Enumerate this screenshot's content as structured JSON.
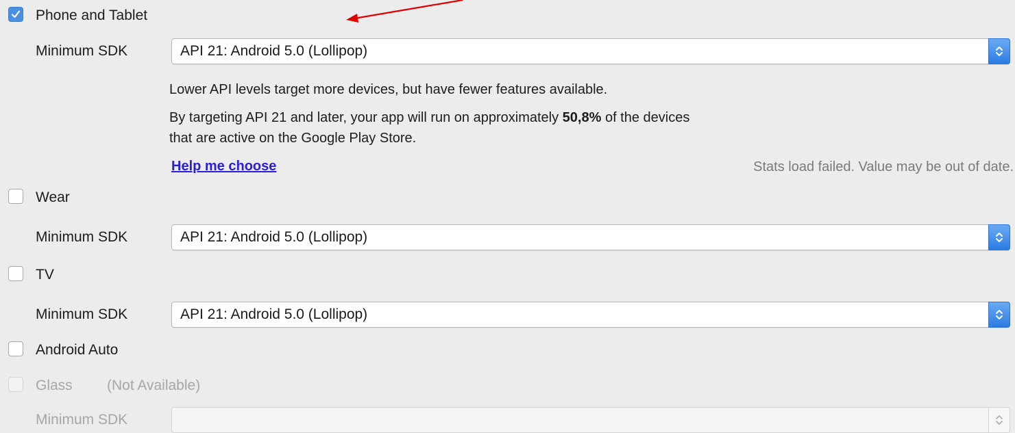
{
  "colors": {
    "accent": "#4a90e2",
    "annotation_arrow": "#e00000",
    "link": "#2a1ed6",
    "muted": "#7a7a7a",
    "disabled": "#a6a6a6",
    "background": "#ececec"
  },
  "phone_tablet": {
    "label": "Phone and Tablet",
    "checked": true,
    "min_sdk_label": "Minimum SDK",
    "min_sdk_value": "API 21: Android 5.0 (Lollipop)",
    "info_line1": "Lower API levels target more devices, but have fewer features available.",
    "info_line2_prefix": "By targeting API 21 and later, your app will run on approximately ",
    "info_line2_percent": "50,8%",
    "info_line2_suffix": " of the devices",
    "info_line3": "that are active on the Google Play Store.",
    "help_link": "Help me choose",
    "stats_warning": "Stats load failed. Value may be out of date."
  },
  "wear": {
    "label": "Wear",
    "checked": false,
    "min_sdk_label": "Minimum SDK",
    "min_sdk_value": "API 21: Android 5.0 (Lollipop)"
  },
  "tv": {
    "label": "TV",
    "checked": false,
    "min_sdk_label": "Minimum SDK",
    "min_sdk_value": "API 21: Android 5.0 (Lollipop)"
  },
  "android_auto": {
    "label": "Android Auto",
    "checked": false
  },
  "glass": {
    "label": "Glass",
    "status": "(Not Available)",
    "checked": false,
    "disabled": true,
    "min_sdk_label": "Minimum SDK",
    "min_sdk_value": ""
  }
}
